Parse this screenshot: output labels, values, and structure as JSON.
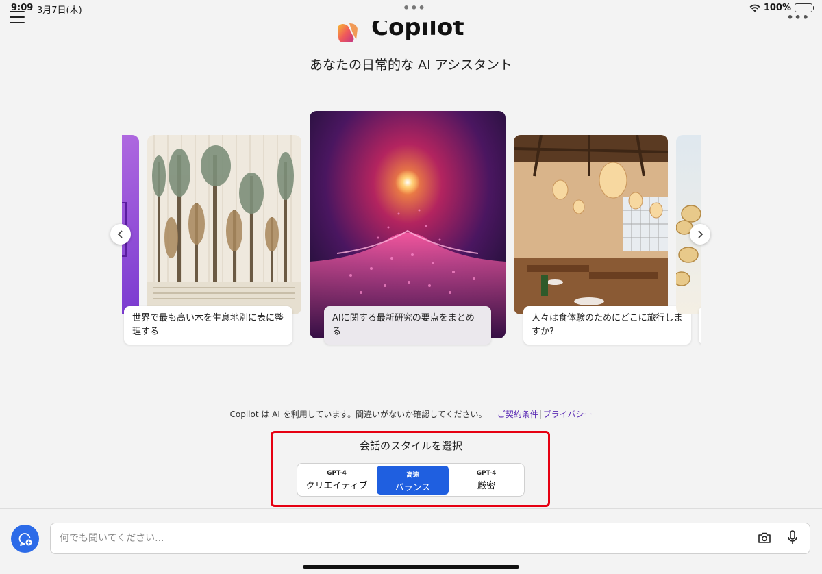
{
  "status_bar": {
    "time": "9:09",
    "date": "3月7日(木)",
    "battery": "100%",
    "battery_level": 1.0
  },
  "header": {
    "app_name": "Copilot",
    "subtitle": "あなたの日常的な AI アシスタント"
  },
  "carousel": {
    "cards": [
      {
        "caption": "世界で最も高い木を生息地別に表に整理する",
        "image": "trees-illustration"
      },
      {
        "caption": "AIに関する最新研究の要点をまとめる",
        "image": "glowing-particle-wave"
      },
      {
        "caption": "人々は食体験のためにどこに旅行しますか?",
        "image": "japanese-restaurant-interior"
      }
    ]
  },
  "disclaimer": {
    "text": "Copilot は AI を利用しています。間違いがないか確認してください。",
    "terms_link": "ご契約条件",
    "privacy_link": "プライバシー"
  },
  "conversation_style": {
    "title": "会話のスタイルを選択",
    "options": [
      {
        "top": "GPT-4",
        "label": "クリエイティブ",
        "selected": false
      },
      {
        "top": "高速",
        "label": "バランス",
        "selected": true
      },
      {
        "top": "GPT-4",
        "label": "厳密",
        "selected": false
      }
    ]
  },
  "input": {
    "placeholder": "何でも聞いてください..."
  },
  "colors": {
    "accent": "#1f5fe0",
    "highlight": "#e60012",
    "link": "#5b2bb5"
  }
}
